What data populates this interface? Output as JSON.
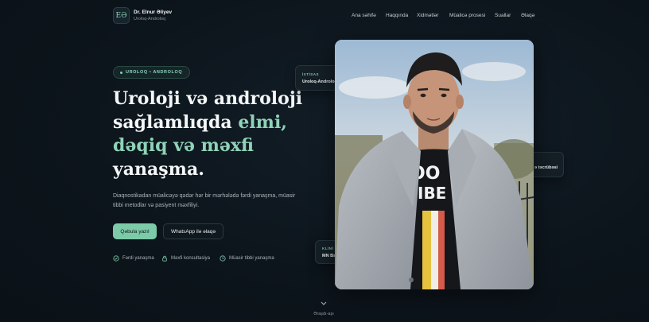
{
  "brand": {
    "monogram": "EƏ",
    "name": "Dr. Elnur Əliyev",
    "subtitle": "Uroloq-Androloq"
  },
  "nav": [
    "Ana səhifə",
    "Haqqında",
    "Xidmətlər",
    "Müalicə prosesi",
    "Suallar",
    "Əlaqə"
  ],
  "hero": {
    "badge": "UROLOQ • ANDROLOQ",
    "headline_line1": "Uroloji və androloji",
    "headline_line2_plain": "sağlamlıqda ",
    "headline_line2_accent": "elmi,",
    "headline_line3_accent": "dəqiq və məxfi",
    "headline_line4": "yanaşma.",
    "description": "Diaqnostikadan müalicəyə qədər hər bir mərhələdə fərdi yanaşma, müasir tibbi metodlar və pasiyent məxfiliyi.",
    "primary_button": "Qəbula yazıl",
    "secondary_button": "WhatsApp ilə əlaqə",
    "features": [
      "Fərdi yanaşma",
      "Məxfi konsultasiya",
      "Müasir tibbi yanaşma"
    ]
  },
  "cards": [
    {
      "kicker": "İXTİSAS",
      "value": "Uroloq-Androloq"
    },
    {
      "kicker": "",
      "value": "ə təcrübəsi"
    },
    {
      "kicker": "KLİNİ",
      "value": "MN Bə"
    }
  ],
  "photo": {
    "shirt_text_1": "OO",
    "shirt_text_2": "IBE"
  },
  "scroll_label": "Əraşdı-aşı",
  "colors": {
    "accent": "#8fd3b8",
    "button": "#7ccaa8",
    "background": "#0d151c"
  },
  "icons": [
    "check-circle-icon",
    "lock-icon",
    "clock-icon",
    "chevron-down-icon"
  ]
}
